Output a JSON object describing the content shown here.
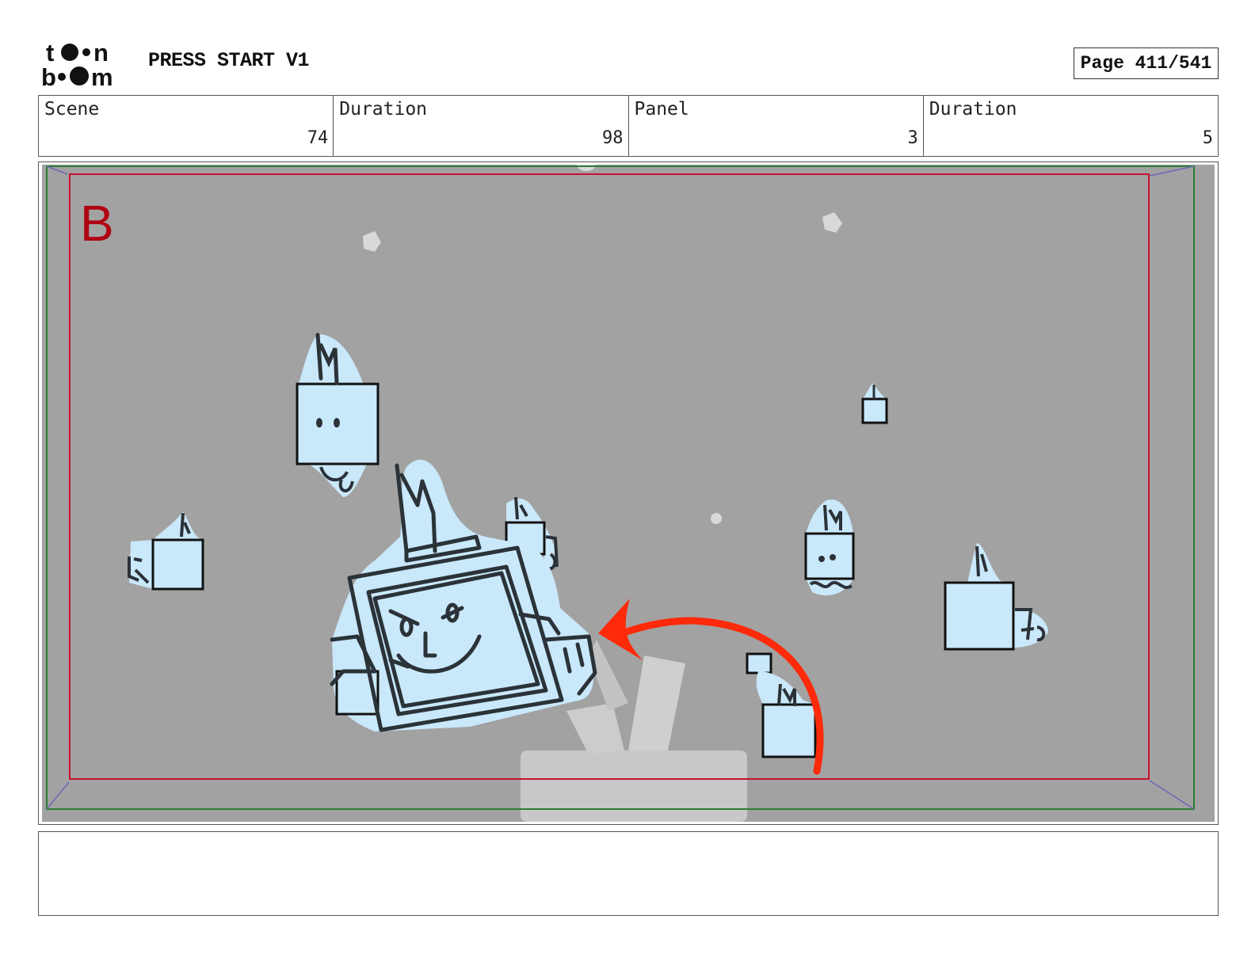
{
  "header": {
    "logo_top": "t●●n",
    "logo_bottom": "b●●m",
    "project_title": "PRESS START V1",
    "page_label": "Page 411/541"
  },
  "info_row": [
    {
      "label": "Scene",
      "value": "74"
    },
    {
      "label": "Duration",
      "value": "98"
    },
    {
      "label": "Panel",
      "value": "3"
    },
    {
      "label": "Duration",
      "value": "5"
    }
  ],
  "panel": {
    "field_letter": "B",
    "colors": {
      "background": "#a2a2a2",
      "safe_frame": "#c8102e",
      "outer_frame": "#2e7d32",
      "character_fill": "#c9e8fa",
      "character_line": "#2b3238",
      "motion_arrow": "#ff2a0a",
      "prop": "#cfcfcf"
    }
  },
  "caption": {
    "text": ""
  }
}
